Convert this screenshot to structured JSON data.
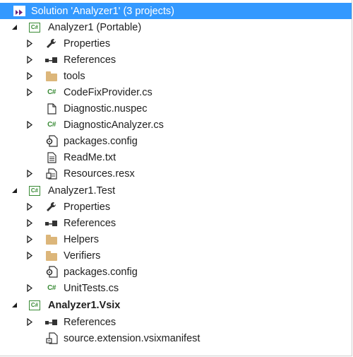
{
  "solution_label": "Solution 'Analyzer1' (3 projects)",
  "items": [
    {
      "label": "Analyzer1 (Portable)",
      "icon": "csharp-project-icon",
      "expander": "expanded"
    },
    {
      "label": "Properties",
      "icon": "wrench-icon",
      "expander": "collapsed"
    },
    {
      "label": "References",
      "icon": "references-icon",
      "expander": "collapsed"
    },
    {
      "label": "tools",
      "icon": "folder-icon",
      "expander": "collapsed"
    },
    {
      "label": "CodeFixProvider.cs",
      "icon": "csharp-file-icon",
      "expander": "collapsed"
    },
    {
      "label": "Diagnostic.nuspec",
      "icon": "file-icon",
      "expander": "none"
    },
    {
      "label": "DiagnosticAnalyzer.cs",
      "icon": "csharp-file-icon",
      "expander": "collapsed"
    },
    {
      "label": "packages.config",
      "icon": "config-file-icon",
      "expander": "none"
    },
    {
      "label": "ReadMe.txt",
      "icon": "text-file-icon",
      "expander": "none"
    },
    {
      "label": "Resources.resx",
      "icon": "resource-file-icon",
      "expander": "collapsed"
    },
    {
      "label": "Analyzer1.Test",
      "icon": "csharp-project-icon",
      "expander": "expanded"
    },
    {
      "label": "Properties",
      "icon": "wrench-icon",
      "expander": "collapsed"
    },
    {
      "label": "References",
      "icon": "references-icon",
      "expander": "collapsed"
    },
    {
      "label": "Helpers",
      "icon": "folder-icon",
      "expander": "collapsed"
    },
    {
      "label": "Verifiers",
      "icon": "folder-icon",
      "expander": "collapsed"
    },
    {
      "label": "packages.config",
      "icon": "config-file-icon",
      "expander": "none"
    },
    {
      "label": "UnitTests.cs",
      "icon": "csharp-file-icon",
      "expander": "collapsed"
    },
    {
      "label": "Analyzer1.Vsix",
      "icon": "csharp-project-icon",
      "expander": "expanded"
    },
    {
      "label": "References",
      "icon": "references-icon",
      "expander": "collapsed"
    },
    {
      "label": "source.extension.vsixmanifest",
      "icon": "manifest-file-icon",
      "expander": "none"
    }
  ],
  "colors": {
    "selection": "#3399ff",
    "csharp_green": "#388a34",
    "folder": "#dcb67a",
    "text": "#1e1e1e"
  }
}
